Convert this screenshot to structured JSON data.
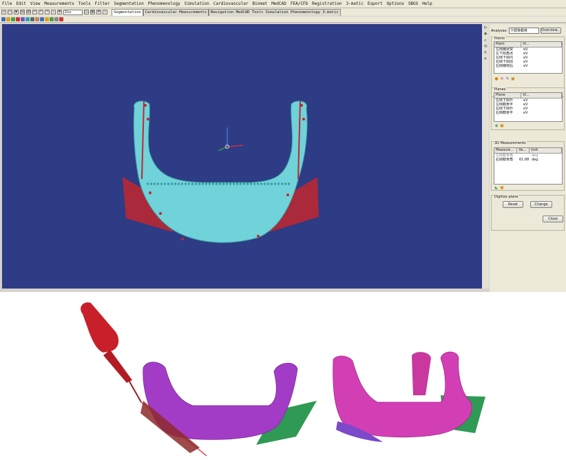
{
  "menu": [
    "File",
    "Edit",
    "View",
    "Measurements",
    "Tools",
    "Filter",
    "Segmentation",
    "Phenomenology",
    "Simulation",
    "Cardiovascular",
    "Biomat",
    "MedCAD",
    "FEA/CFD",
    "Registration",
    "3-matic",
    "Export",
    "Options",
    "SBGS",
    "Help"
  ],
  "toolbar": {
    "zoom_value": "Ziu"
  },
  "tabs": [
    "Segmentation",
    "Cardiovascular Measurements",
    "Navigation MedCAD Tools Simulation Phenomenology 3-matic"
  ],
  "panel": {
    "analyses_label": "Analyses:",
    "analyses_value": "下颌骨截骨",
    "overview_button": "Overview...",
    "points_title": "Points",
    "points_columns": [
      "Point",
      "Vi..."
    ],
    "points": [
      {
        "name": "左侧髁状突",
        "vis": "eV"
      },
      {
        "name": "左下颌角点",
        "vis": "eV"
      },
      {
        "name": "左侧下颌内",
        "vis": "eV"
      },
      {
        "name": "右侧下颌前",
        "vis": "eV"
      },
      {
        "name": "右侧髁突后",
        "vis": "eV"
      }
    ],
    "planes_title": "Planes",
    "planes_columns": [
      "Plane",
      "Vi..."
    ],
    "planes": [
      {
        "name": "左侧下颌升",
        "vis": "eV"
      },
      {
        "name": "左侧截骨平",
        "vis": "eV"
      },
      {
        "name": "右侧下颌升",
        "vis": "eV"
      },
      {
        "name": "右侧截骨平",
        "vis": "eV"
      }
    ],
    "measurements_title": "3D Measurements",
    "measurements_columns": [
      "Measure...",
      "Va...",
      "Unit"
    ],
    "measurements": [
      {
        "name": "左侧截骨角",
        "value": "",
        "unit": "deg"
      },
      {
        "name": "右侧截骨角",
        "value": "61.88",
        "unit": "deg"
      }
    ],
    "digitize_title": "Digitize plane",
    "reset_button": "Reset",
    "change_button": "Change",
    "close_button": "Close"
  },
  "colors": {
    "viewport_bg": "#2e3b85",
    "mandible_cyan": "#6fd3d9",
    "cut_plane_red": "#c0272d",
    "mandible_purple": "#a23cc6",
    "mandible_magenta": "#d23fb5",
    "osteotomy_plane_green": "#2f9a54",
    "saw_red": "#c8202a"
  }
}
